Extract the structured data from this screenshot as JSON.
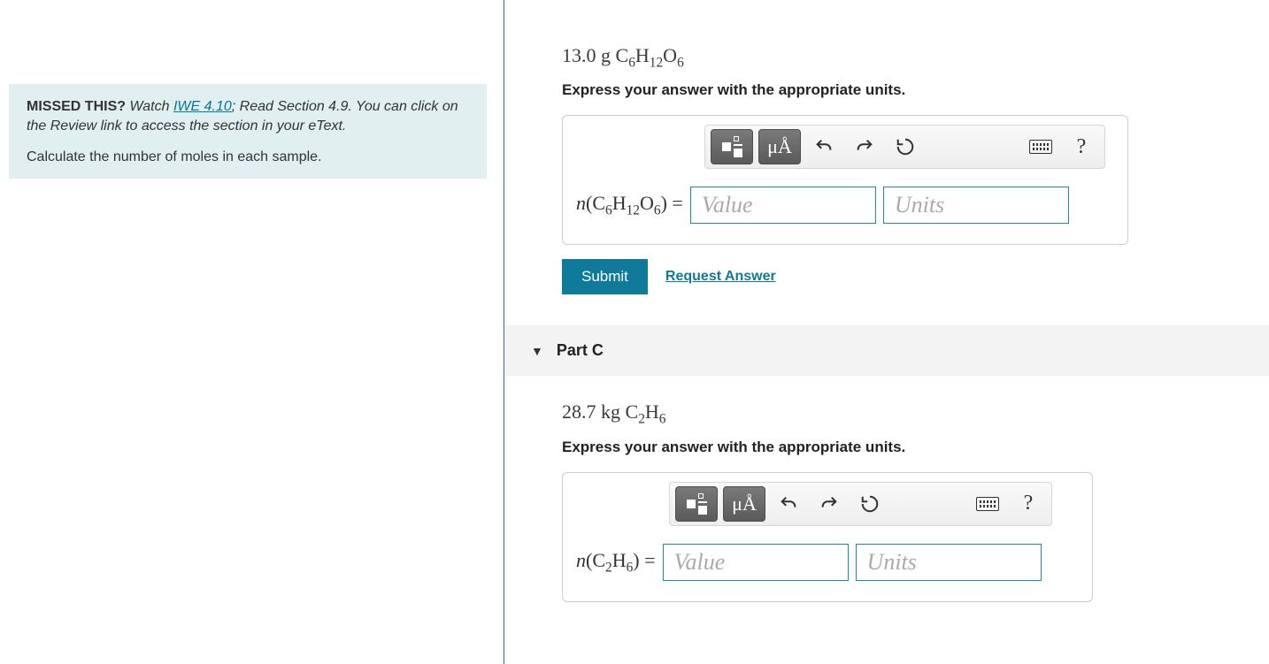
{
  "left": {
    "missed_prefix": "MISSED THIS?",
    "missed_text_1": " Watch ",
    "missed_link": "IWE 4.10",
    "missed_text_2": "; Read Section 4.9. You can click on the Review link to access the section in your eText.",
    "task": "Calculate the number of moles in each sample."
  },
  "partB": {
    "formula_prefix": "13.0 g ",
    "formula_compound": "C6H12O6",
    "instruction": "Express your answer with the appropriate units.",
    "lhs_var": "n",
    "lhs_compound": "C6H12O6",
    "equals": " = ",
    "value_placeholder": "Value",
    "units_placeholder": "Units",
    "toolbar_unit_label": "μÅ",
    "help_label": "?",
    "submit_label": "Submit",
    "request_label": "Request Answer"
  },
  "partC": {
    "header": "Part C",
    "formula_prefix": "28.7 kg ",
    "formula_compound": "C2H6",
    "instruction": "Express your answer with the appropriate units.",
    "lhs_var": "n",
    "lhs_compound": "C2H6",
    "equals": " = ",
    "value_placeholder": "Value",
    "units_placeholder": "Units",
    "toolbar_unit_label": "μÅ",
    "help_label": "?"
  }
}
